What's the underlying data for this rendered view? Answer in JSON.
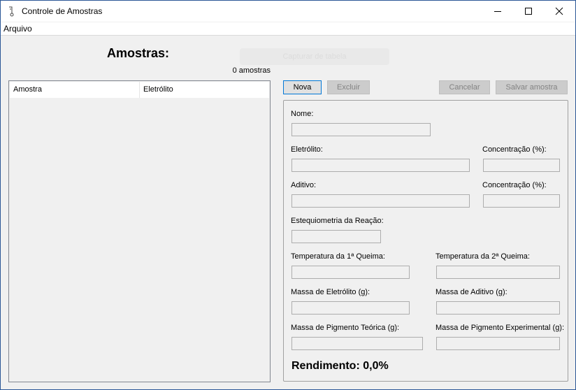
{
  "window": {
    "title": "Controle de Amostras",
    "icon": "thermometer-icon",
    "controls": [
      "minimize-icon",
      "maximize-icon",
      "close-icon"
    ]
  },
  "menu": {
    "file": "Arquivo"
  },
  "sidebar": {
    "heading": "Amostras:",
    "faded_button": "Capturar de tabela",
    "count": "0 amostras",
    "columns": [
      "Amostra",
      "Eletrólito"
    ],
    "rows": []
  },
  "toolbar": {
    "new": "Nova",
    "delete": "Excluir",
    "cancel": "Cancelar",
    "save": "Salvar amostra"
  },
  "form": {
    "name_label": "Nome:",
    "electrolyte_label": "Eletrólito:",
    "electrolyte_conc_label": "Concentração (%):",
    "additive_label": "Aditivo:",
    "additive_conc_label": "Concentração (%):",
    "stoichiometry_label": "Estequiometria da Reação:",
    "temp1_label": "Temperatura da 1ª Queima:",
    "temp2_label": "Temperatura da 2ª Queima:",
    "mass_electrolyte_label": "Massa de Eletrólito (g):",
    "mass_additive_label": "Massa de Aditivo (g):",
    "mass_pigment_theoretical_label": "Massa de Pigmento Teórica (g):",
    "mass_pigment_experimental_label": "Massa de Pigmento Experimental (g):",
    "values": {
      "name": "",
      "electrolyte": "",
      "electrolyte_conc": "",
      "additive": "",
      "additive_conc": "",
      "stoichiometry": "",
      "temp1": "",
      "temp2": "",
      "mass_electrolyte": "",
      "mass_additive": "",
      "mass_pigment_theoretical": "",
      "mass_pigment_experimental": ""
    },
    "yield": "Rendimento: 0,0%"
  }
}
